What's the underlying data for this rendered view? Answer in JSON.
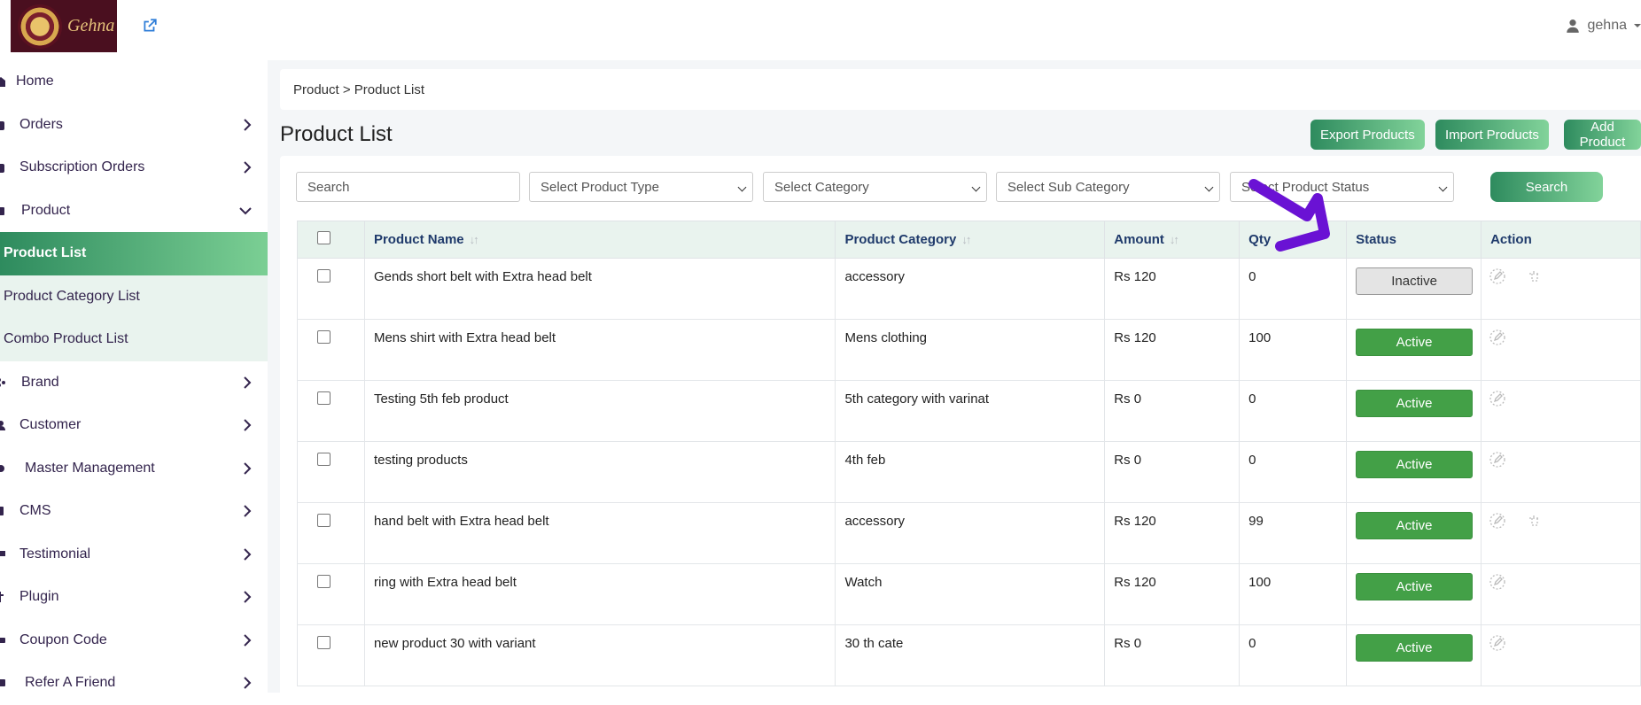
{
  "header": {
    "logo_text": "Gehna",
    "user_name": "gehna"
  },
  "sidebar": {
    "items": [
      {
        "label": "Home",
        "icon": "home-icon"
      },
      {
        "label": "Orders",
        "icon": "orders-icon"
      },
      {
        "label": "Subscription Orders",
        "icon": "subscription-icon"
      },
      {
        "label": "Product",
        "icon": "product-icon"
      },
      {
        "label": "Brand",
        "icon": "brand-icon"
      },
      {
        "label": "Customer",
        "icon": "customer-icon"
      },
      {
        "label": "Master Management",
        "icon": "settings-icon"
      },
      {
        "label": "CMS",
        "icon": "cms-icon"
      },
      {
        "label": "Testimonial",
        "icon": "testimonial-icon"
      },
      {
        "label": "Plugin",
        "icon": "plugin-icon"
      },
      {
        "label": "Coupon Code",
        "icon": "coupon-icon"
      },
      {
        "label": "Refer A Friend",
        "icon": "refer-icon"
      }
    ],
    "sub_items": [
      "Product List",
      "Product Category List",
      "Combo Product List"
    ]
  },
  "breadcrumb": "Product > Product List",
  "page_title": "Product List",
  "actions": {
    "export": "Export Products",
    "import": "Import Products",
    "add": "Add Product"
  },
  "filters": {
    "search_placeholder": "Search",
    "product_type": "Select Product Type",
    "category": "Select Category",
    "sub_category": "Select Sub Category",
    "status": "Select Product Status",
    "search_button": "Search"
  },
  "table": {
    "columns": [
      "Product Name",
      "Product Category",
      "Amount",
      "Qty",
      "Status",
      "Action"
    ],
    "rows": [
      {
        "name": "Gends short belt with Extra head belt",
        "category": "accessory",
        "amount": "Rs 120",
        "qty": "0",
        "status": "Inactive"
      },
      {
        "name": "Mens shirt with Extra head belt",
        "category": "Mens clothing",
        "amount": "Rs 120",
        "qty": "100",
        "status": "Active"
      },
      {
        "name": "Testing 5th feb product",
        "category": "5th category with varinat",
        "amount": "Rs 0",
        "qty": "0",
        "status": "Active"
      },
      {
        "name": "testing products",
        "category": "4th feb",
        "amount": "Rs 0",
        "qty": "0",
        "status": "Active"
      },
      {
        "name": "hand belt with Extra head belt",
        "category": "accessory",
        "amount": "Rs 120",
        "qty": "99",
        "status": "Active"
      },
      {
        "name": "ring with Extra head belt",
        "category": "Watch",
        "amount": "Rs 120",
        "qty": "100",
        "status": "Active"
      },
      {
        "name": "new product 30 with variant",
        "category": "30 th cate",
        "amount": "Rs 0",
        "qty": "0",
        "status": "Active"
      }
    ]
  },
  "colors": {
    "accent_green": "#2e8b5e",
    "active_status": "#43a047",
    "header_text": "#1f3a6b",
    "annotation": "#6a12d4"
  }
}
